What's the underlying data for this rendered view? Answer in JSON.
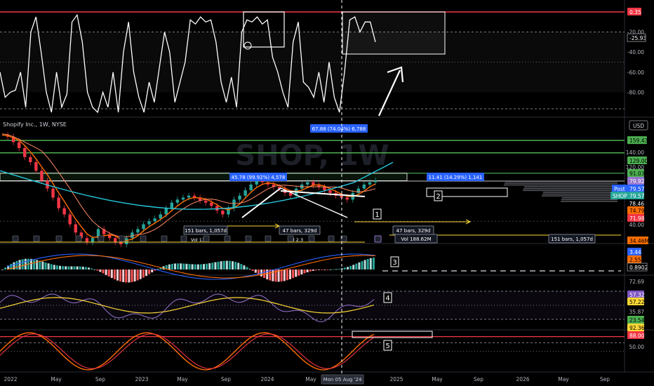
{
  "window": {
    "symbol_title": "Shopify Inc., 1W, NYSE",
    "watermark": "SHOP, 1W",
    "currency": "USD",
    "crosshair_date": "Mon 05 Aug '24"
  },
  "colors": {
    "background": "#000000",
    "red_line": "#f23645",
    "green_line": "#4caf50",
    "blue_badge": "#2962ff",
    "teal": "#26a69a",
    "orange": "#ff6d00",
    "white": "#ffffff",
    "yellow": "#fdd835",
    "purple": "#9575cd"
  },
  "chart_data": [
    {
      "panel": "oscillator_top",
      "type": "line",
      "y_ticks": [
        "-20.00",
        "-40.00",
        "-60.00",
        "-80.00"
      ],
      "labels": {
        "top": "0.35",
        "current": "-25.93"
      },
      "series": [
        {
          "values": [
            -60,
            -85,
            -80,
            -78,
            -60,
            -95,
            -20,
            -5,
            -40,
            -80,
            -100,
            -60,
            -95,
            -82,
            -10,
            -3,
            -30,
            -80,
            -95,
            -100,
            -80,
            -95,
            -60,
            -100,
            -40,
            -10,
            -60,
            -85,
            -100,
            -70,
            -90,
            -55,
            -20,
            -40,
            -90,
            -70,
            -50,
            -8,
            -12,
            -5,
            -10,
            -8,
            -30,
            -70,
            -90,
            -65,
            -95,
            -20,
            -8,
            -10,
            -5,
            -12,
            -8,
            -45,
            -60,
            -80,
            -95,
            -30,
            -10,
            -70,
            -75,
            -85,
            -60,
            -90,
            -50,
            -85,
            -100,
            -60,
            -8,
            -5,
            -20,
            -10,
            -10,
            -30
          ]
        }
      ]
    },
    {
      "panel": "price",
      "type": "line",
      "y_ticks": [
        "159.43",
        "140.00",
        "129.00",
        "120.00",
        "91.03",
        "79.92",
        "79.57",
        "79.57",
        "78.46",
        "74.79",
        "71.98",
        "40.00"
      ],
      "price_tags": {
        "post": "Post",
        "ticker": "SHOP"
      },
      "x_ticks": [
        "2022",
        "May",
        "Sep",
        "2023",
        "May",
        "Sep",
        "2024",
        "May",
        "2025",
        "May",
        "Sep",
        "2026",
        "May",
        "Sep"
      ],
      "series": [
        {
          "values": [
            175,
            170,
            155,
            140,
            120,
            110,
            95,
            80,
            70,
            60,
            50,
            45,
            38,
            33,
            30,
            28,
            30,
            35,
            32,
            30,
            28,
            27,
            30,
            33,
            35,
            38,
            40,
            42,
            45,
            50,
            55,
            58,
            60,
            62,
            60,
            57,
            55,
            52,
            48,
            45,
            50,
            58,
            62,
            68,
            75,
            80,
            78,
            75,
            72,
            70,
            65,
            62,
            70,
            75,
            78,
            74,
            72,
            68,
            65,
            62,
            60,
            58,
            65,
            70,
            75,
            78,
            80
          ]
        }
      ],
      "annotations": [
        "67.88 (74.04%) 6,788",
        "45.78 (99.92%) 4,578",
        "11.41 (14.29%) 1,141",
        "151 bars, 1,057d",
        "Vol 13.2",
        "47 bars, 329d",
        "Vol 2.3",
        "47 bars, 329d",
        "Vol 188.62M",
        "151 bars, 1,057d",
        "34.46M",
        "1",
        "2"
      ]
    },
    {
      "panel": "macd",
      "type": "bar",
      "y_ticks": [
        "3.44",
        "2.55",
        "0.8902"
      ],
      "labels": [
        "3"
      ]
    },
    {
      "panel": "rsi",
      "type": "line",
      "y_ticks": [
        "72.69",
        "57.32",
        "57.22",
        "35.87",
        "23.54"
      ],
      "labels": [
        "4"
      ]
    },
    {
      "panel": "stochastic",
      "type": "line",
      "y_ticks": [
        "92.36",
        "88.00",
        "50.00"
      ],
      "labels": [
        "5"
      ]
    }
  ]
}
